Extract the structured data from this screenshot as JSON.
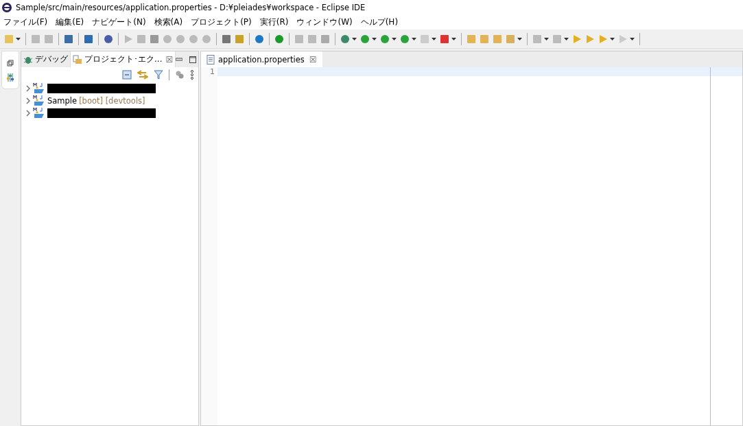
{
  "window": {
    "title": "Sample/src/main/resources/application.properties - D:¥pleiades¥workspace - Eclipse IDE"
  },
  "menu": [
    {
      "label": "ファイル(F)"
    },
    {
      "label": "編集(E)"
    },
    {
      "label": "ナビゲート(N)"
    },
    {
      "label": "検索(A)"
    },
    {
      "label": "プロジェクト(P)"
    },
    {
      "label": "実行(R)"
    },
    {
      "label": "ウィンドウ(W)"
    },
    {
      "label": "ヘルプ(H)"
    }
  ],
  "left_panel": {
    "tabs": [
      {
        "kind": "debug",
        "label": "デバッグ",
        "selected": false
      },
      {
        "kind": "explorer",
        "label": "プロジェクト･エク...",
        "selected": true,
        "close": "☒"
      }
    ],
    "tree": [
      {
        "kind": "redacted",
        "expanded": false
      },
      {
        "kind": "project",
        "label": "Sample",
        "decorations": "[boot] [devtools]",
        "expanded": false
      },
      {
        "kind": "redacted",
        "expanded": false
      }
    ]
  },
  "editor": {
    "tabs": [
      {
        "label": "application.properties",
        "selected": true,
        "close": "☒"
      }
    ],
    "line_numbers": [
      "1"
    ]
  }
}
